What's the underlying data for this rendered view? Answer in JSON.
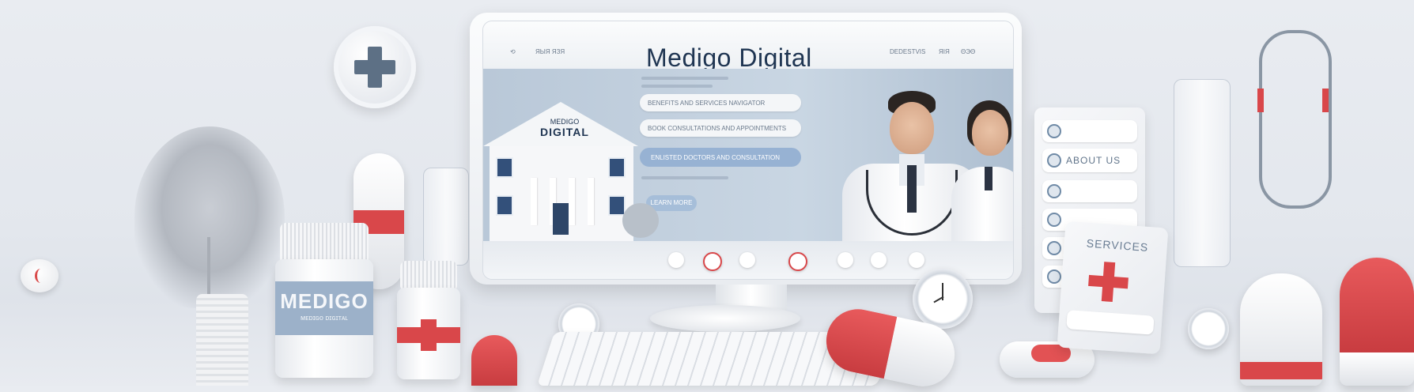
{
  "monitor": {
    "brand_title": "Medigo Digital",
    "nav_left": [
      "⟲",
      "ЯЫЯ ЯЗЯ"
    ],
    "nav_right": [
      "DEDESTVIS",
      "ЯIЯ",
      "ΘЭΘ"
    ],
    "building_sign_line1": "MEDIGO",
    "building_sign_line2": "DIGITAL",
    "hero_field_1": "BENEFITS AND SERVICES NAVIGATOR",
    "hero_field_2": "BOOK CONSULTATIONS AND APPOINTMENTS",
    "hero_button": "ENLISTED DOCTORS AND CONSULTATION",
    "small_button": "LEARN MORE"
  },
  "bottle": {
    "label_main": "MEDIGO",
    "label_sub": "ᴍᴇᴅɪɢᴏ ᴅɪɢɪᴛᴀʟ"
  },
  "right_panel": {
    "row_label": "ABOUT US"
  },
  "services_card": {
    "title": "SERVICES"
  },
  "colors": {
    "accent_red": "#d9474a",
    "accent_blue": "#9cb1c9",
    "navy": "#1f3552"
  },
  "icons": [
    "plus-icon",
    "stethoscope-icon",
    "clock-icon",
    "pill-icon",
    "keyboard-icon"
  ]
}
